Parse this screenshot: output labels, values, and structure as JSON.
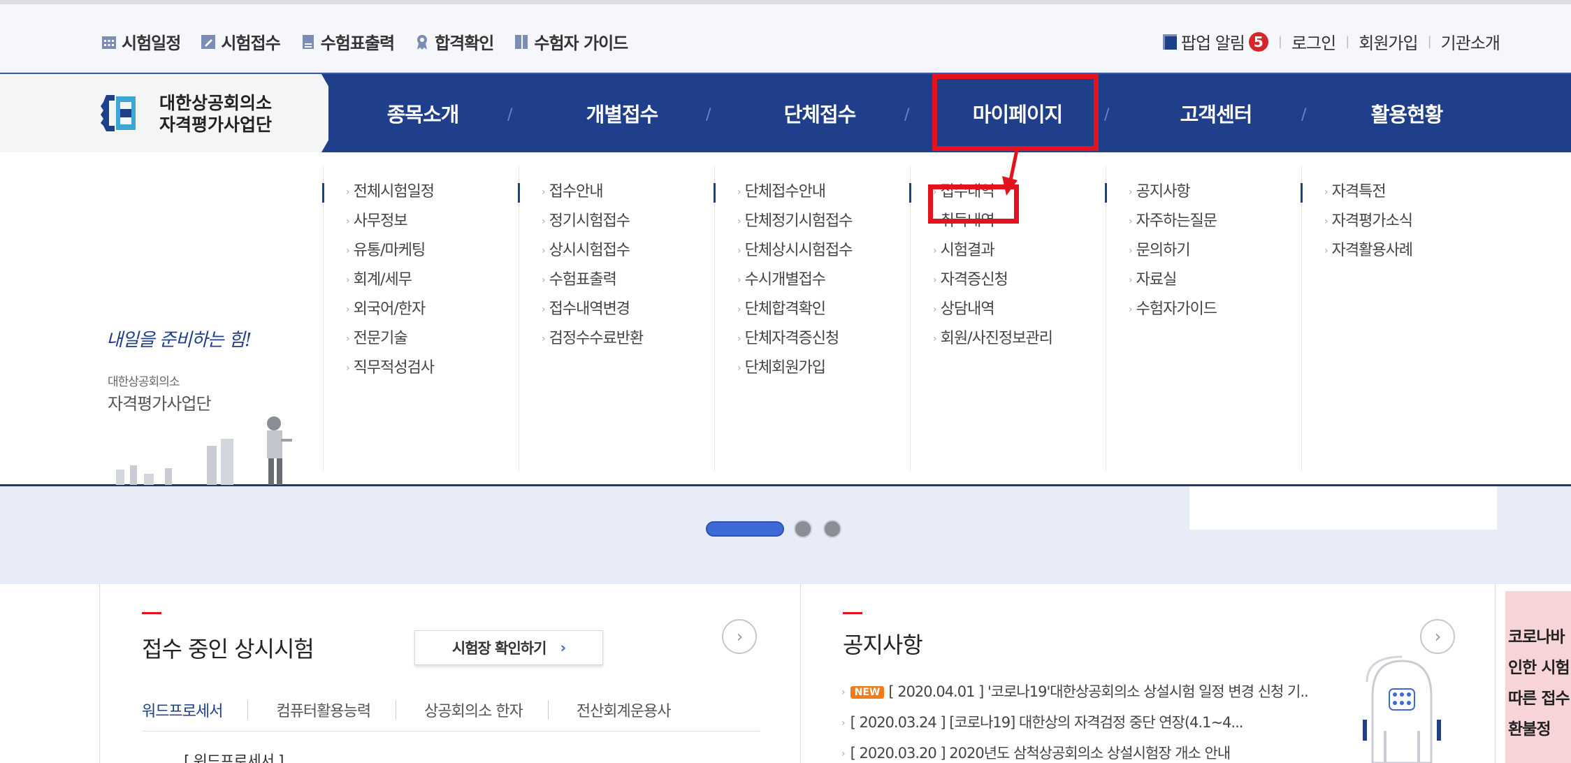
{
  "utility": {
    "left_items": [
      {
        "label": "시험일정",
        "icon": "calendar-icon"
      },
      {
        "label": "시험접수",
        "icon": "pen-icon"
      },
      {
        "label": "수험표출력",
        "icon": "card-icon"
      },
      {
        "label": "합격확인",
        "icon": "ribbon-icon"
      },
      {
        "label": "수험자 가이드",
        "icon": "book-icon"
      }
    ],
    "popup_label": "팝업 알림",
    "popup_count": "5",
    "login": "로그인",
    "signup": "회원가입",
    "about": "기관소개"
  },
  "logo": {
    "line1": "대한상공회의소",
    "line2": "자격평가사업단"
  },
  "nav": [
    "종목소개",
    "개별접수",
    "단체접수",
    "마이페이지",
    "고객센터",
    "활용현황"
  ],
  "submenus": [
    [
      "전체시험일정",
      "사무정보",
      "유통/마케팅",
      "회계/세무",
      "외국어/한자",
      "전문기술",
      "직무적성검사"
    ],
    [
      "접수안내",
      "정기시험접수",
      "상시시험접수",
      "수험표출력",
      "접수내역변경",
      "검정수수료반환"
    ],
    [
      "단체접수안내",
      "단체정기시험접수",
      "단체상시시험접수",
      "수시개별접수",
      "단체합격확인",
      "단체자격증신청",
      "단체회원가입"
    ],
    [
      "접수내역",
      "취득내역",
      "시험결과",
      "자격증신청",
      "상담내역",
      "회원/사진정보관리"
    ],
    [
      "공지사항",
      "자주하는질문",
      "문의하기",
      "자료실",
      "수험자가이드"
    ],
    [
      "자격특전",
      "자격평가소식",
      "자격활용사례"
    ]
  ],
  "promo": {
    "script": "내일을 준비하는 힘!",
    "org_small": "대한상공회의소",
    "org_large": "자격평가사업단"
  },
  "panel1": {
    "title": "접수 중인 상시시험",
    "button": "시험장 확인하기",
    "button_chevron": "›",
    "more": "›",
    "tabs": [
      "워드프로세서",
      "컴퓨터활용능력",
      "상공회의소 한자",
      "전산회계운용사"
    ],
    "sub_label": "[ 워드프로세서 ]"
  },
  "panel2": {
    "title": "공지사항",
    "more": "›",
    "new_badge": "NEW",
    "notices": [
      "[ 2020.04.01 ] '코로나19'대한상공회의소 상설시험 일정 변경 신청 기..",
      "[ 2020.03.24 ] [코로나19] 대한상의 자격검정 중단 연장(4.1~4...",
      "[ 2020.03.20 ] 2020년도 삼척상공회의소 상설시험장 개소 안내"
    ]
  },
  "side_banner": {
    "lines": [
      "코로나바",
      "인한 시험",
      "따른 접수",
      "환불정"
    ]
  }
}
